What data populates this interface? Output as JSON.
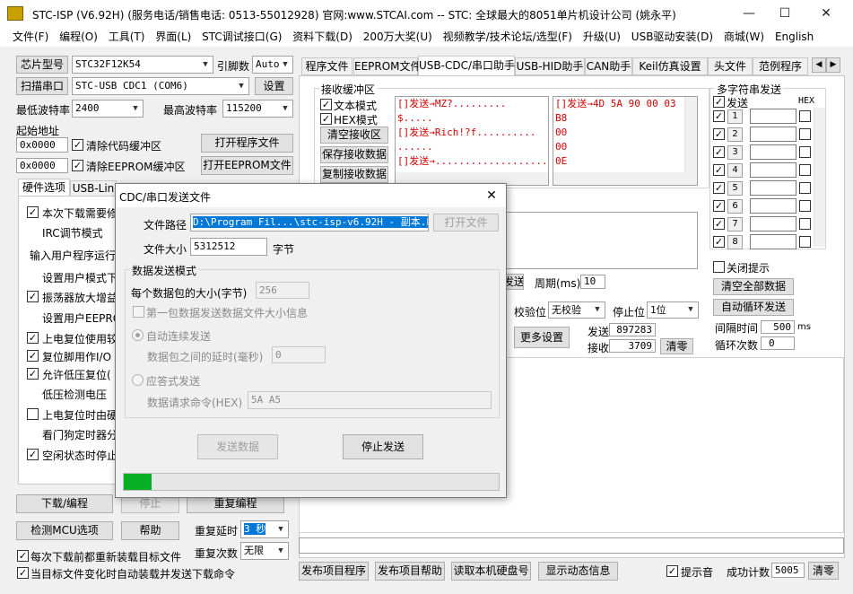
{
  "window": {
    "title": "STC-ISP (V6.92H) (服务电话/销售电话: 0513-55012928) 官网:www.STCAI.com  -- STC: 全球最大的8051单片机设计公司 (姚永平)",
    "minimize": "—",
    "maximize": "☐",
    "close": "✕"
  },
  "menu": [
    "文件(F)",
    "编程(O)",
    "工具(T)",
    "界面(L)",
    "STC调试接口(G)",
    "资料下载(D)",
    "200万大奖(U)",
    "视频教学/技术论坛/选型(F)",
    "升级(U)",
    "USB驱动安装(D)",
    "商城(W)",
    "English"
  ],
  "left": {
    "chip_btn": "芯片型号",
    "chip_value": "STC32F12K54",
    "pins_label": "引脚数",
    "pins_value": "Auto",
    "scan_btn": "扫描串口",
    "port_value": "STC-USB CDC1 (COM6)",
    "settings_btn": "设置",
    "min_baud_label": "最低波特率",
    "min_baud_value": "2400",
    "max_baud_label": "最高波特率",
    "max_baud_value": "115200",
    "start_addr_label": "起始地址",
    "addr1": "0x0000",
    "clear_code": "清除代码缓冲区",
    "open_prog": "打开程序文件",
    "addr2": "0x0000",
    "clear_eeprom": "清除EEPROM缓冲区",
    "open_eeprom": "打开EEPROM文件",
    "tab_hw": "硬件选项",
    "tab_usb": "USB-Lin",
    "options": [
      "本次下载需要修",
      "IRC调节模式",
      "输入用户程序运行",
      "设置用户模式下",
      "振荡器放大增益",
      "设置用户EEPRO",
      "上电复位使用较",
      "复位脚用作I/O",
      "允许低压复位(",
      "低压检测电压",
      "上电复位时由硬",
      "看门狗定时器分",
      "空闲状态时停止"
    ],
    "download_btn": "下载/编程",
    "stop_btn": "停止",
    "reprogram_btn": "重复编程",
    "detect_btn": "检测MCU选项",
    "help_btn": "帮助",
    "repeat_delay_label": "重复延时",
    "repeat_delay_value": "3 秒",
    "repeat_count_label": "重复次数",
    "repeat_count_value": "无限",
    "reload_chk": "每次下载前都重新装载目标文件",
    "auto_send_chk": "当目标文件变化时自动装载并发送下载命令"
  },
  "right": {
    "tabs": [
      "程序文件",
      "EEPROM文件",
      "USB-CDC/串口助手",
      "USB-HID助手",
      "CAN助手",
      "Keil仿真设置",
      "头文件",
      "范例程序"
    ],
    "recv_group": "接收缓冲区",
    "text_mode": "文本模式",
    "hex_mode": "HEX模式",
    "clear_recv": "清空接收区",
    "save_recv": "保存接收数据",
    "copy_recv": "复制接收数据",
    "recv_left": [
      "[]发送→MZ?.........",
      "                  $.....",
      "[]发送→Rich!?f..........",
      "                  ......",
      "[]发送→......................"
    ],
    "recv_right": [
      "[]发送→4D 5A 90 00 03",
      "                  B8",
      "                  00",
      "                  00",
      "                  0E"
    ],
    "send_btn_partial": "发送",
    "period_label": "周期(ms)",
    "period_value": "10",
    "parity_label": "校验位",
    "parity_value": "无校验",
    "stop_bit_label": "停止位",
    "stop_bit_value": "1位",
    "more_settings": "更多设置",
    "send_label": "发送",
    "send_count": "897283",
    "recv_label": "接收",
    "recv_count": "3709",
    "clear_count": "清零",
    "multi_title": "多字符串发送",
    "multi_send": "发送",
    "multi_hex": "HEX",
    "rows": [
      "1",
      "2",
      "3",
      "4",
      "5",
      "6",
      "7",
      "8"
    ],
    "close_tip": "关闭提示",
    "clear_all": "清空全部数据",
    "auto_loop": "自动循环发送",
    "interval_label": "间隔时间",
    "interval_value": "500",
    "interval_unit": "ms",
    "loop_count_label": "循环次数",
    "loop_count_value": "0"
  },
  "bottom": {
    "publish_prog": "发布项目程序",
    "publish_help": "发布项目帮助",
    "read_disk": "读取本机硬盘号",
    "show_info": "显示动态信息",
    "beep_chk": "提示音",
    "success_label": "成功计数",
    "success_value": "5005",
    "clear_btn": "清零"
  },
  "dialog": {
    "title": "CDC/串口发送文件",
    "close": "✕",
    "path_label": "文件路径",
    "path_value": "D:\\Program Fil...\\stc-isp-v6.92H - 副本.bin",
    "open_file": "打开文件",
    "size_label": "文件大小",
    "size_value": "5312512",
    "size_unit": "字节",
    "mode_group": "数据发送模式",
    "packet_label": "每个数据包的大小(字节)",
    "packet_value": "256",
    "first_packet_chk": "第一包数据发送数据文件大小信息",
    "auto_send_radio": "自动连续发送",
    "delay_label": "数据包之间的延时(毫秒)",
    "delay_value": "0",
    "reply_radio": "应答式发送",
    "req_cmd_label": "数据请求命令(HEX)",
    "req_cmd_value": "5A A5",
    "send_data_btn": "发送数据",
    "stop_send_btn": "停止发送",
    "progress": 0.075
  },
  "colors": {
    "progress": "#06b025",
    "recv_text": "#d40000",
    "selection": "#0078d7"
  }
}
